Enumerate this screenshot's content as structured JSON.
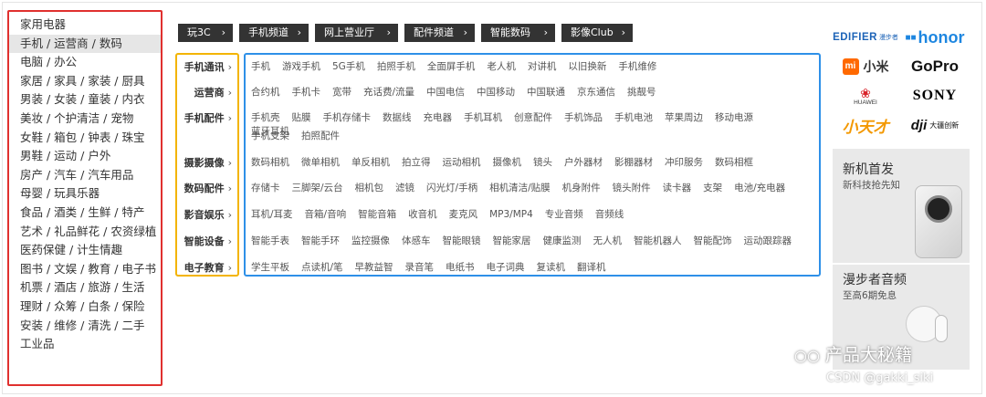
{
  "sidebar": {
    "items": [
      "家用电器",
      "手机 / 运营商 / 数码",
      "电脑 / 办公",
      "家居 / 家具 / 家装 / 厨具",
      "男装 / 女装 / 童装 / 内衣",
      "美妆 / 个护清洁 / 宠物",
      "女鞋 / 箱包 / 钟表 / 珠宝",
      "男鞋 / 运动 / 户外",
      "房产 / 汽车 / 汽车用品",
      "母婴 / 玩具乐器",
      "食品 / 酒类 / 生鲜 / 特产",
      "艺术 / 礼品鲜花 / 农资绿植",
      "医药保健 / 计生情趣",
      "图书 / 文娱 / 教育 / 电子书",
      "机票 / 酒店 / 旅游 / 生活",
      "理财 / 众筹 / 白条 / 保险",
      "安装 / 维修 / 清洗 / 二手",
      "工业品"
    ],
    "active_index": 1,
    "border_color": "#e0302e"
  },
  "tabs": [
    "玩3C",
    "手机频道",
    "网上营业厅",
    "配件频道",
    "智能数码",
    "影像Club"
  ],
  "categories": [
    {
      "label": "手机通讯",
      "lines": [
        [
          "手机",
          "游戏手机",
          "5G手机",
          "拍照手机",
          "全面屏手机",
          "老人机",
          "对讲机",
          "以旧换新",
          "手机维修"
        ]
      ]
    },
    {
      "label": "运营商",
      "lines": [
        [
          "合约机",
          "手机卡",
          "宽带",
          "充话费/流量",
          "中国电信",
          "中国移动",
          "中国联通",
          "京东通信",
          "挑靓号"
        ]
      ]
    },
    {
      "label": "手机配件",
      "lines": [
        [
          "手机壳",
          "贴膜",
          "手机存储卡",
          "数据线",
          "充电器",
          "手机耳机",
          "创意配件",
          "手机饰品",
          "手机电池",
          "苹果周边",
          "移动电源",
          "蓝牙耳机"
        ],
        [
          "手机支架",
          "拍照配件"
        ]
      ]
    },
    {
      "label": "摄影摄像",
      "lines": [
        [
          "数码相机",
          "微单相机",
          "单反相机",
          "拍立得",
          "运动相机",
          "摄像机",
          "镜头",
          "户外器材",
          "影棚器材",
          "冲印服务",
          "数码相框"
        ]
      ]
    },
    {
      "label": "数码配件",
      "lines": [
        [
          "存储卡",
          "三脚架/云台",
          "相机包",
          "滤镜",
          "闪光灯/手柄",
          "相机清洁/贴膜",
          "机身附件",
          "镜头附件",
          "读卡器",
          "支架",
          "电池/充电器"
        ]
      ]
    },
    {
      "label": "影音娱乐",
      "lines": [
        [
          "耳机/耳麦",
          "音箱/音响",
          "智能音箱",
          "收音机",
          "麦克风",
          "MP3/MP4",
          "专业音频",
          "音频线"
        ]
      ]
    },
    {
      "label": "智能设备",
      "lines": [
        [
          "智能手表",
          "智能手环",
          "监控摄像",
          "体感车",
          "智能眼镜",
          "智能家居",
          "健康监测",
          "无人机",
          "智能机器人",
          "智能配饰",
          "运动跟踪器"
        ]
      ]
    },
    {
      "label": "电子教育",
      "lines": [
        [
          "学生平板",
          "点读机/笔",
          "早教益智",
          "录音笔",
          "电纸书",
          "电子词典",
          "复读机",
          "翻译机"
        ]
      ]
    }
  ],
  "label_box_color": "#f3b400",
  "links_box_color": "#2e90e8",
  "brands": {
    "edifier": "EDIFIER",
    "edifier_cn": "漫步者",
    "honor": "honor",
    "mi": "mi",
    "mi_cn": "小米",
    "gopro": "GoPro",
    "huawei": "HUAWEI",
    "sony": "SONY",
    "xtc": "小天才",
    "dji": "dji",
    "dji_cn": "大疆创新"
  },
  "promos": [
    {
      "title": "新机首发",
      "subtitle": "新科技抢先知"
    },
    {
      "title": "漫步者音频",
      "subtitle": "至高6期免息"
    }
  ],
  "watermark": {
    "main": "产品大秘籍",
    "sub": "CSDN @gakki_siki"
  }
}
